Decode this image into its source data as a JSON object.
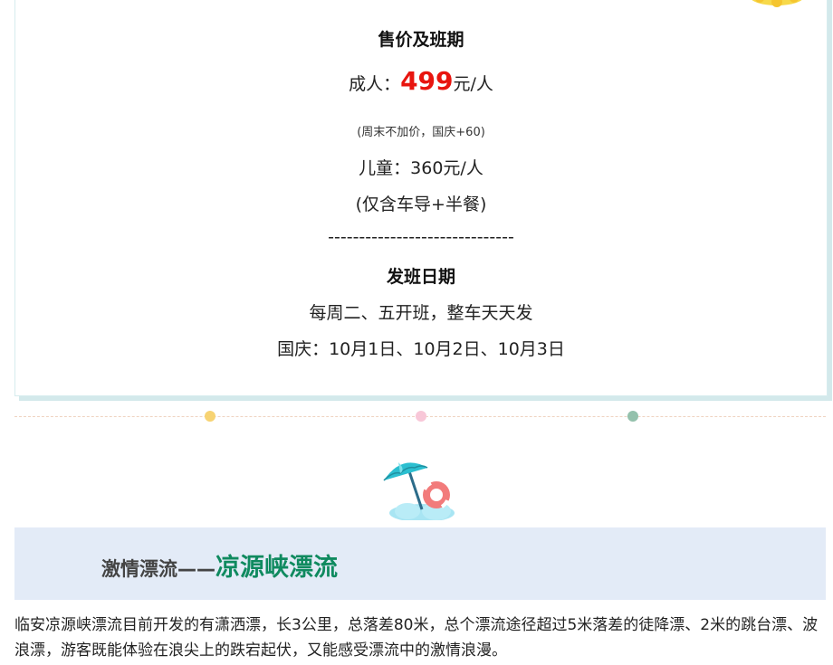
{
  "price_section": {
    "title": "售价及班期",
    "adult_prefix": "成人：",
    "adult_price": "499",
    "adult_suffix": "元/人",
    "note": "(周末不加价，国庆+60)",
    "child": "儿童：360元/人",
    "includes": "(仅含车导+半餐)",
    "separator": "------------------------------",
    "schedule_title": "发班日期",
    "schedule_weekly": "每周二、五开班，整车天天发",
    "schedule_national": "国庆：10月1日、10月2日、10月3日"
  },
  "divider": {
    "dot_colors": [
      "#f7d372",
      "#f8c7d8",
      "#94c1ac"
    ]
  },
  "colors": {
    "price_red": "#e8150f",
    "heading_green": "#0f8a5f",
    "banner_bg": "#e3ebf7"
  },
  "section_banner": {
    "prefix": "激情漂流——",
    "title": "凉源峡漂流",
    "icon": "beach-umbrella-icon"
  },
  "description": "临安凉源峡漂流目前开发的有潇洒漂，长3公里，总落差80米，总个漂流途径超过5米落差的徒降漂、2米的跳台漂、波浪漂，游客既能体验在浪尖上的跌宕起伏，又能感受漂流中的激情浪漫。"
}
